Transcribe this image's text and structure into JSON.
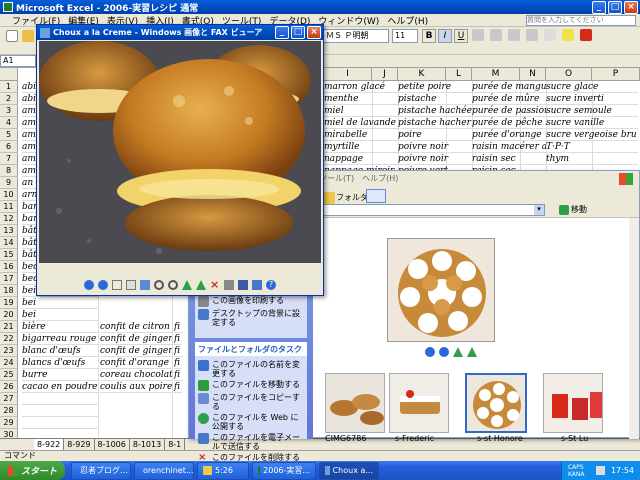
{
  "excel": {
    "title": "Microsoft Excel - 2006-実習レシピ  通常",
    "menus": [
      "ファイル(F)",
      "編集(E)",
      "表示(V)",
      "挿入(I)",
      "書式(O)",
      "ツール(T)",
      "データ(D)",
      "ウィンドウ(W)",
      "ヘルプ(H)"
    ],
    "help_placeholder": "質問を入力してください",
    "font_name": "ＭＳ Ｐ明朝",
    "font_size": "11",
    "columns": [
      "I",
      "J",
      "K",
      "L",
      "M",
      "N",
      "O",
      "P"
    ],
    "rows": [
      {
        "num": "1",
        "a": "abi",
        "i": "marron glacé",
        "k": "petite poire",
        "m": "purée de mangue",
        "o": "sucre glace"
      },
      {
        "num": "2",
        "a": "abi",
        "i": "menthe",
        "k": "pistache",
        "m": "purée de mûre",
        "o": "sucre inverti"
      },
      {
        "num": "3",
        "a": "am",
        "i": "miel",
        "k": "pistache hachée",
        "m": "purée de passion",
        "o": "sucre semoule"
      },
      {
        "num": "4",
        "a": "am",
        "i": "miel de lavande",
        "k": "pistache hacher",
        "m": "purée de pêche sa",
        "o": "sucre vanille"
      },
      {
        "num": "5",
        "a": "am",
        "i": "mirabelle",
        "k": "poire",
        "m": "purée d'orange",
        "o": "sucre vergeoise bru"
      },
      {
        "num": "6",
        "a": "am",
        "i": "myrtille",
        "k": "poivre noir",
        "m": "raisin macérer au",
        "o": "T·P·T"
      },
      {
        "num": "7",
        "a": "am",
        "i": "nappage",
        "k": "poivre noir",
        "m": "raisin sec",
        "o": "thym"
      },
      {
        "num": "8",
        "a": "am",
        "i": "nappage miroir",
        "k": "poivre vert",
        "m": "raisin sec",
        "o": ""
      },
      {
        "num": "9",
        "a": "an",
        "i": "",
        "k": "",
        "m": "",
        "o": ""
      },
      {
        "num": "10",
        "a": "arn",
        "i": "",
        "k": "",
        "m": "",
        "o": "tron"
      },
      {
        "num": "11",
        "a": "bar",
        "i": "",
        "k": "",
        "m": "",
        "o": "tron"
      },
      {
        "num": "12",
        "a": "bar",
        "i": "",
        "k": "",
        "m": "",
        "o": "trovert"
      },
      {
        "num": "13",
        "a": "bât",
        "i": "",
        "k": "",
        "m": "",
        "o": "ron"
      },
      {
        "num": "14",
        "a": "bât",
        "i": "",
        "k": "",
        "m": "",
        "o": "ange"
      },
      {
        "num": "15",
        "a": "bât",
        "i": "",
        "k": "",
        "m": "",
        "o": ""
      },
      {
        "num": "16",
        "a": "bec",
        "i": "",
        "k": "",
        "m": "",
        "o": ""
      },
      {
        "num": "17",
        "a": "bec",
        "i": "",
        "k": "",
        "m": "",
        "o": ""
      },
      {
        "num": "18",
        "a": "bei",
        "i": "",
        "k": "",
        "m": "",
        "o": ""
      },
      {
        "num": "19",
        "a": "bei",
        "i": "",
        "k": "",
        "m": "",
        "o": ""
      },
      {
        "num": "20",
        "a": "bei",
        "i": "",
        "k": "",
        "m": "",
        "o": ""
      },
      {
        "num": "21",
        "a": "bière",
        "b": "confit de citron",
        "c": "fi"
      },
      {
        "num": "22",
        "a": "bigarreau rouge",
        "b": "confit de gingembi",
        "c": "fi"
      },
      {
        "num": "23",
        "a": "blanc d'œufs",
        "b": "confit de gingembi",
        "c": "fi"
      },
      {
        "num": "24",
        "a": "blancs d'œufs",
        "b": "confit d'orange",
        "c": "fi"
      },
      {
        "num": "25",
        "a": "burre",
        "b": "coreau chocolat",
        "c": "fi"
      },
      {
        "num": "26",
        "a": "cacao en poudre",
        "b": "coulis aux poires",
        "c": "fi"
      },
      {
        "num": "27",
        "a": ""
      },
      {
        "num": "28",
        "a": ""
      },
      {
        "num": "29",
        "a": ""
      },
      {
        "num": "30",
        "a": ""
      },
      {
        "num": "31",
        "a": ""
      },
      {
        "num": "32",
        "a": ""
      }
    ],
    "sheet_tabs": [
      "8-922",
      "8-929",
      "8-1006",
      "8-1013",
      "8-1"
    ],
    "status": "コマンド",
    "cell_ref": "A1"
  },
  "viewer": {
    "title": "Choux a la Creme - Windows 画像と FAX ビューア"
  },
  "explorer": {
    "menus": [
      "ツール(T)",
      "ヘルプ(H)"
    ],
    "folder_label": "フォルダ",
    "go_label": "移動",
    "image_tasks_partial": [
      "この画像を印刷する",
      "デスクトップの背景に設定する"
    ],
    "file_tasks_title": "ファイルとフォルダのタスク",
    "file_tasks": [
      {
        "label": "このファイルの名前を変更する",
        "color": "#3b6fd1"
      },
      {
        "label": "このファイルを移動する",
        "color": "#2f9c3a"
      },
      {
        "label": "このファイルをコピーする",
        "color": "#6a8bd1"
      },
      {
        "label": "このファイルを Web に公開する",
        "color": "#2fa04a"
      },
      {
        "label": "このファイルを電子メールで送信する",
        "color": "#4a78c8"
      },
      {
        "label": "このファイルを削除する",
        "color": "#c8281a"
      }
    ],
    "thumbnails": [
      "CIMG6786",
      "s-Frederic",
      "s-st Honore",
      "s-St Lu"
    ]
  },
  "taskbar": {
    "start": "スタート",
    "items": [
      "忍者ブログ...",
      "orenchinet...",
      "5:26",
      "2006-実習...",
      "Choux a..."
    ],
    "clock": "17:54",
    "caps": "CAPS KANA"
  }
}
